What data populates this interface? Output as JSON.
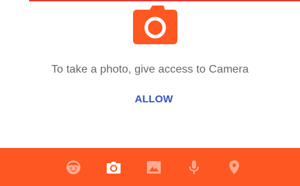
{
  "permission": {
    "message": "To take a photo, give access to Camera",
    "allow_label": "ALLOW"
  },
  "icons": {
    "header": "camera-icon",
    "tabs": [
      "emoji-icon",
      "camera-icon",
      "gallery-icon",
      "microphone-icon",
      "location-pin-icon"
    ]
  },
  "bottom_bar": {
    "selected_tab": "camera"
  },
  "colors": {
    "accent": "#ff5722",
    "accent_line": "#e53935",
    "button_text": "#3154c8",
    "message_text": "#666666",
    "tab_icon_inactive": "#ffab91",
    "tab_icon_active": "#ffffff"
  }
}
